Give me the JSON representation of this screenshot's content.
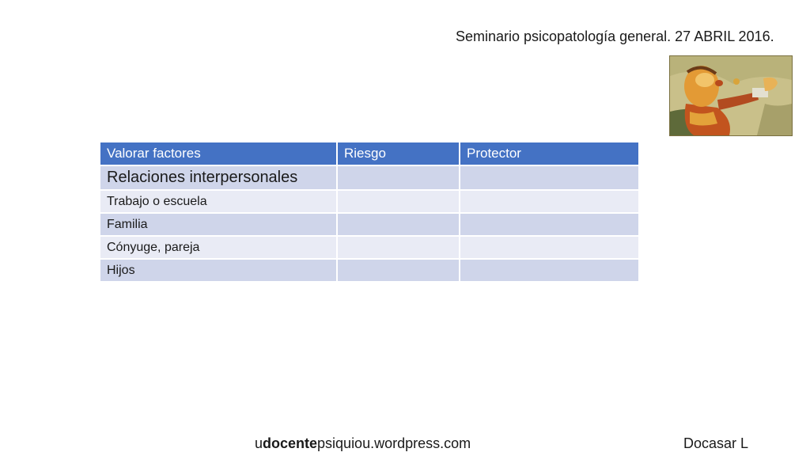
{
  "header": {
    "title": "Seminario psicopatología general. 27 ABRIL 2016."
  },
  "table": {
    "headers": [
      "Valorar factores",
      "Riesgo",
      "Protector"
    ],
    "rows": [
      [
        "Relaciones interpersonales",
        "",
        ""
      ],
      [
        "Trabajo o escuela",
        "",
        ""
      ],
      [
        "Familia",
        "",
        ""
      ],
      [
        "Cónyuge, pareja",
        "",
        ""
      ],
      [
        "Hijos",
        "",
        ""
      ]
    ]
  },
  "footer": {
    "url_prefix": "u",
    "url_bold": "docente",
    "url_suffix": "psiquiou.wordpress.com",
    "author": "Docasar L"
  },
  "colors": {
    "header_fill": "#4472c4",
    "row_dark": "#cfd5ea",
    "row_light": "#e9ebf5"
  }
}
